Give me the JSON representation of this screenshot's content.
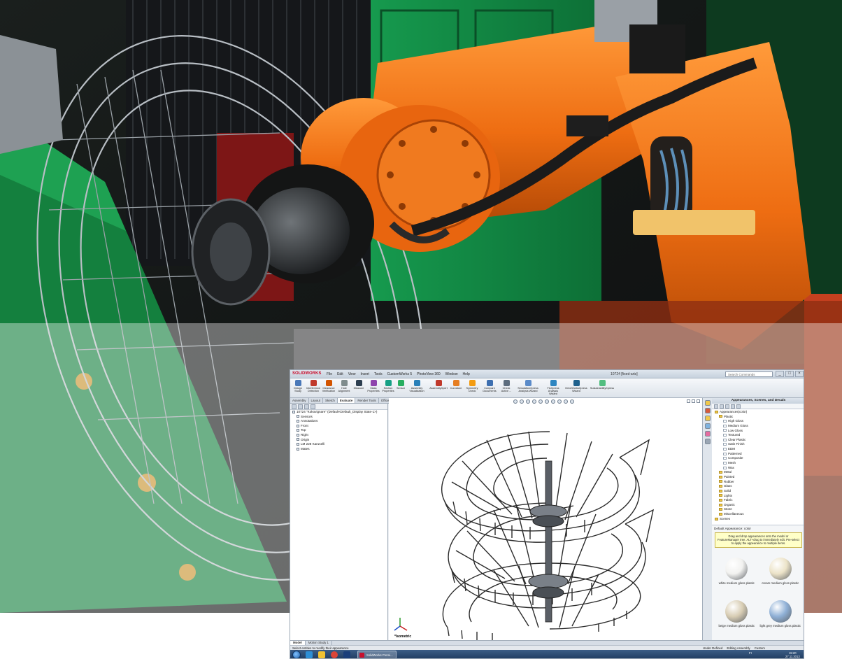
{
  "app": {
    "logo": "SOLIDWORKS",
    "menus": [
      "File",
      "Edit",
      "View",
      "Insert",
      "Tools",
      "CustomWorks 5",
      "PhotoView 360",
      "Window",
      "Help"
    ],
    "document_title": "10724 [fixed-arts]",
    "search_placeholder": "Search Commands",
    "window_buttons": [
      "_",
      "□",
      "×"
    ]
  },
  "ribbon": {
    "buttons": [
      {
        "label": "Design\nStudy",
        "color": "#4a78b8"
      },
      {
        "label": "Interference\nDetection",
        "color": "#c0392b"
      },
      {
        "label": "Clearance\nVerification",
        "color": "#d35400"
      },
      {
        "label": "Hole\nAlignment",
        "color": "#7f8c8d"
      },
      {
        "label": "Measure",
        "color": "#2c3e50"
      },
      {
        "label": "Mass\nProperties",
        "color": "#8e44ad"
      },
      {
        "label": "Section\nProperties",
        "color": "#16a085"
      },
      {
        "label": "Sensor",
        "color": "#27ae60"
      },
      {
        "label": "Assembly\nVisualization",
        "color": "#2980b9"
      },
      {
        "label": "AssemblyXpert",
        "color": "#c0392b"
      },
      {
        "label": "Curvature",
        "color": "#e67e22"
      },
      {
        "label": "Symmetry\nCheck",
        "color": "#f39c12"
      },
      {
        "label": "Compare\nDocuments",
        "color": "#3d6fb0"
      },
      {
        "label": "Check\nActive ...",
        "color": "#5d6d7e"
      },
      {
        "label": "SimulationXpress\nAnalysis Wizard",
        "color": "#5b8bc9"
      },
      {
        "label": "FloXpress\nAnalysis\nWizard",
        "color": "#2e86c1"
      },
      {
        "label": "DriveWorksXpress\nWizard",
        "color": "#1f618d"
      },
      {
        "label": "SustainabilityXpress",
        "color": "#52be80"
      }
    ]
  },
  "command_tabs": [
    {
      "label": "Assembly",
      "active": false
    },
    {
      "label": "Layout",
      "active": false
    },
    {
      "label": "Sketch",
      "active": false
    },
    {
      "label": "Evaluate",
      "active": true
    },
    {
      "label": "Render Tools",
      "active": false
    },
    {
      "label": "Office Products",
      "active": false
    }
  ],
  "feature_tree": [
    {
      "label": "10724 \"Kokovignare\"  (Default<Default_Display State-1>)",
      "depth": 0
    },
    {
      "label": "Sensors",
      "depth": 1
    },
    {
      "label": "Annotations",
      "depth": 1
    },
    {
      "label": "Front",
      "depth": 1
    },
    {
      "label": "Top",
      "depth": 1
    },
    {
      "label": "Right",
      "depth": 1
    },
    {
      "label": "Origin",
      "depth": 1
    },
    {
      "label": "LM 228 Karuselli",
      "depth": 1
    },
    {
      "label": "Mates",
      "depth": 1
    }
  ],
  "viewport": {
    "view_label": "*Isometric"
  },
  "task_pane": {
    "title": "Appearances, Scenes, and Decals",
    "tree": [
      {
        "label": "Appearances(color)",
        "depth": 0,
        "leaf": false
      },
      {
        "label": "Plastic",
        "depth": 1,
        "leaf": false
      },
      {
        "label": "High Gloss",
        "depth": 2,
        "leaf": true
      },
      {
        "label": "Medium Gloss",
        "depth": 2,
        "leaf": true
      },
      {
        "label": "Low Gloss",
        "depth": 2,
        "leaf": true
      },
      {
        "label": "Textured",
        "depth": 2,
        "leaf": true
      },
      {
        "label": "Clear Plastic",
        "depth": 2,
        "leaf": true
      },
      {
        "label": "Satin Finish",
        "depth": 2,
        "leaf": true
      },
      {
        "label": "EDM",
        "depth": 2,
        "leaf": true
      },
      {
        "label": "Patterned",
        "depth": 2,
        "leaf": true
      },
      {
        "label": "Composite",
        "depth": 2,
        "leaf": true
      },
      {
        "label": "Mesh",
        "depth": 2,
        "leaf": true
      },
      {
        "label": "Wax",
        "depth": 2,
        "leaf": true
      },
      {
        "label": "Metal",
        "depth": 1,
        "leaf": false
      },
      {
        "label": "Painted",
        "depth": 1,
        "leaf": false
      },
      {
        "label": "Rubber",
        "depth": 1,
        "leaf": false
      },
      {
        "label": "Glass",
        "depth": 1,
        "leaf": false
      },
      {
        "label": "Solid",
        "depth": 1,
        "leaf": false
      },
      {
        "label": "Lights",
        "depth": 1,
        "leaf": false
      },
      {
        "label": "Fabric",
        "depth": 1,
        "leaf": false
      },
      {
        "label": "Organic",
        "depth": 1,
        "leaf": false
      },
      {
        "label": "Stone",
        "depth": 1,
        "leaf": false
      },
      {
        "label": "Miscellaneous",
        "depth": 1,
        "leaf": false
      },
      {
        "label": "Scenes",
        "depth": 0,
        "leaf": false
      }
    ],
    "default_appearance": "Default Appearance: color",
    "tip": "Drag and drop appearances onto the model or FeatureManager tree. ALT+drag to immediately edit. Pre-select to apply the appearance to multiple items.",
    "swatches": [
      {
        "label": "white medium gloss plastic",
        "color": "#f2f2f0"
      },
      {
        "label": "cream medium gloss plastic",
        "color": "#ece3c8"
      },
      {
        "label": "beige medium gloss plastic",
        "color": "#d8cdb4"
      },
      {
        "label": "light grey medium gloss plastic",
        "color": "#8fb0d6"
      }
    ]
  },
  "bottom_tabs": [
    {
      "label": "Model",
      "active": true
    },
    {
      "label": "Motion Study 1",
      "active": false
    }
  ],
  "status_bar": {
    "left": "Select entities to modify their appearance",
    "right": [
      "Under Defined",
      "Editing Assembly",
      "Custom"
    ]
  },
  "taskbar": {
    "active_window": "SolidWorks Premi...",
    "tray_lang": "FI",
    "time": "15:20",
    "date": "27.11.2013",
    "icons": [
      {
        "name": "ie-icon",
        "color": "#2d8fd6"
      },
      {
        "name": "folder-icon",
        "color": "#f1c232"
      },
      {
        "name": "chrome-icon",
        "color": "#db4437"
      },
      {
        "name": "photoshop-icon",
        "color": "#1b3f7a"
      }
    ]
  }
}
